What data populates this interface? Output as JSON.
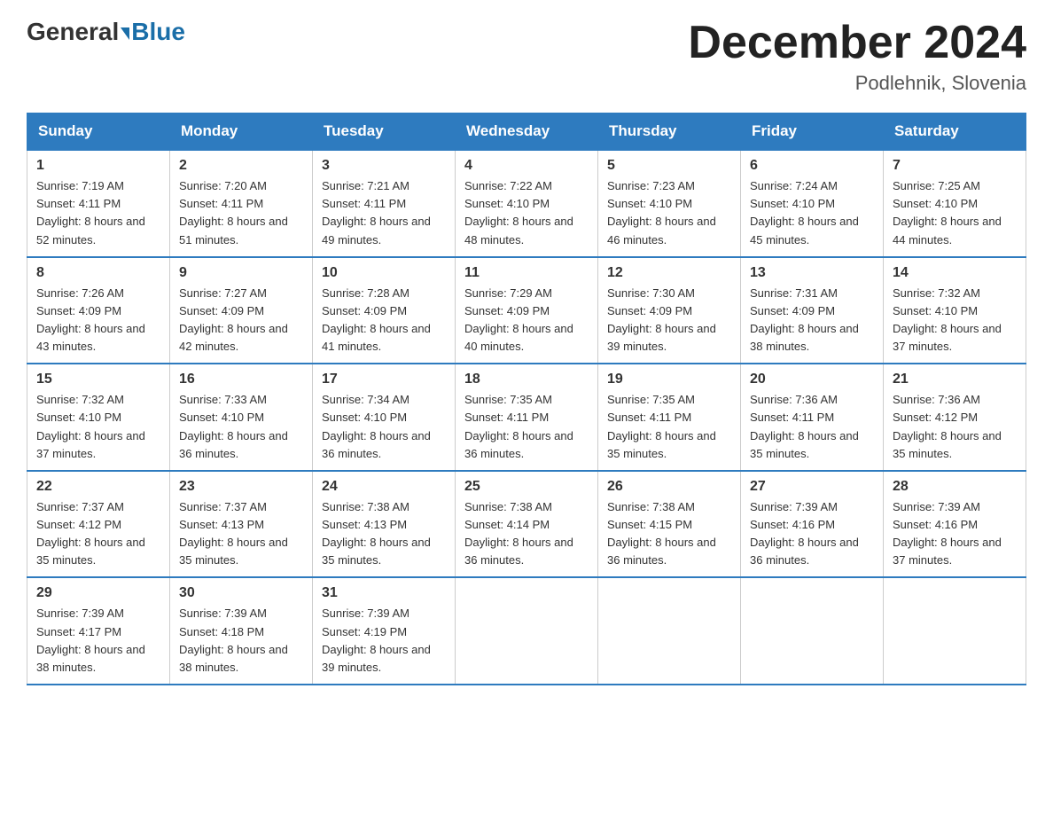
{
  "header": {
    "logo_general": "General",
    "logo_blue": "Blue",
    "month_title": "December 2024",
    "location": "Podlehnik, Slovenia"
  },
  "days_of_week": [
    "Sunday",
    "Monday",
    "Tuesday",
    "Wednesday",
    "Thursday",
    "Friday",
    "Saturday"
  ],
  "weeks": [
    [
      {
        "day": "1",
        "sunrise": "7:19 AM",
        "sunset": "4:11 PM",
        "daylight": "8 hours and 52 minutes."
      },
      {
        "day": "2",
        "sunrise": "7:20 AM",
        "sunset": "4:11 PM",
        "daylight": "8 hours and 51 minutes."
      },
      {
        "day": "3",
        "sunrise": "7:21 AM",
        "sunset": "4:11 PM",
        "daylight": "8 hours and 49 minutes."
      },
      {
        "day": "4",
        "sunrise": "7:22 AM",
        "sunset": "4:10 PM",
        "daylight": "8 hours and 48 minutes."
      },
      {
        "day": "5",
        "sunrise": "7:23 AM",
        "sunset": "4:10 PM",
        "daylight": "8 hours and 46 minutes."
      },
      {
        "day": "6",
        "sunrise": "7:24 AM",
        "sunset": "4:10 PM",
        "daylight": "8 hours and 45 minutes."
      },
      {
        "day": "7",
        "sunrise": "7:25 AM",
        "sunset": "4:10 PM",
        "daylight": "8 hours and 44 minutes."
      }
    ],
    [
      {
        "day": "8",
        "sunrise": "7:26 AM",
        "sunset": "4:09 PM",
        "daylight": "8 hours and 43 minutes."
      },
      {
        "day": "9",
        "sunrise": "7:27 AM",
        "sunset": "4:09 PM",
        "daylight": "8 hours and 42 minutes."
      },
      {
        "day": "10",
        "sunrise": "7:28 AM",
        "sunset": "4:09 PM",
        "daylight": "8 hours and 41 minutes."
      },
      {
        "day": "11",
        "sunrise": "7:29 AM",
        "sunset": "4:09 PM",
        "daylight": "8 hours and 40 minutes."
      },
      {
        "day": "12",
        "sunrise": "7:30 AM",
        "sunset": "4:09 PM",
        "daylight": "8 hours and 39 minutes."
      },
      {
        "day": "13",
        "sunrise": "7:31 AM",
        "sunset": "4:09 PM",
        "daylight": "8 hours and 38 minutes."
      },
      {
        "day": "14",
        "sunrise": "7:32 AM",
        "sunset": "4:10 PM",
        "daylight": "8 hours and 37 minutes."
      }
    ],
    [
      {
        "day": "15",
        "sunrise": "7:32 AM",
        "sunset": "4:10 PM",
        "daylight": "8 hours and 37 minutes."
      },
      {
        "day": "16",
        "sunrise": "7:33 AM",
        "sunset": "4:10 PM",
        "daylight": "8 hours and 36 minutes."
      },
      {
        "day": "17",
        "sunrise": "7:34 AM",
        "sunset": "4:10 PM",
        "daylight": "8 hours and 36 minutes."
      },
      {
        "day": "18",
        "sunrise": "7:35 AM",
        "sunset": "4:11 PM",
        "daylight": "8 hours and 36 minutes."
      },
      {
        "day": "19",
        "sunrise": "7:35 AM",
        "sunset": "4:11 PM",
        "daylight": "8 hours and 35 minutes."
      },
      {
        "day": "20",
        "sunrise": "7:36 AM",
        "sunset": "4:11 PM",
        "daylight": "8 hours and 35 minutes."
      },
      {
        "day": "21",
        "sunrise": "7:36 AM",
        "sunset": "4:12 PM",
        "daylight": "8 hours and 35 minutes."
      }
    ],
    [
      {
        "day": "22",
        "sunrise": "7:37 AM",
        "sunset": "4:12 PM",
        "daylight": "8 hours and 35 minutes."
      },
      {
        "day": "23",
        "sunrise": "7:37 AM",
        "sunset": "4:13 PM",
        "daylight": "8 hours and 35 minutes."
      },
      {
        "day": "24",
        "sunrise": "7:38 AM",
        "sunset": "4:13 PM",
        "daylight": "8 hours and 35 minutes."
      },
      {
        "day": "25",
        "sunrise": "7:38 AM",
        "sunset": "4:14 PM",
        "daylight": "8 hours and 36 minutes."
      },
      {
        "day": "26",
        "sunrise": "7:38 AM",
        "sunset": "4:15 PM",
        "daylight": "8 hours and 36 minutes."
      },
      {
        "day": "27",
        "sunrise": "7:39 AM",
        "sunset": "4:16 PM",
        "daylight": "8 hours and 36 minutes."
      },
      {
        "day": "28",
        "sunrise": "7:39 AM",
        "sunset": "4:16 PM",
        "daylight": "8 hours and 37 minutes."
      }
    ],
    [
      {
        "day": "29",
        "sunrise": "7:39 AM",
        "sunset": "4:17 PM",
        "daylight": "8 hours and 38 minutes."
      },
      {
        "day": "30",
        "sunrise": "7:39 AM",
        "sunset": "4:18 PM",
        "daylight": "8 hours and 38 minutes."
      },
      {
        "day": "31",
        "sunrise": "7:39 AM",
        "sunset": "4:19 PM",
        "daylight": "8 hours and 39 minutes."
      },
      null,
      null,
      null,
      null
    ]
  ]
}
